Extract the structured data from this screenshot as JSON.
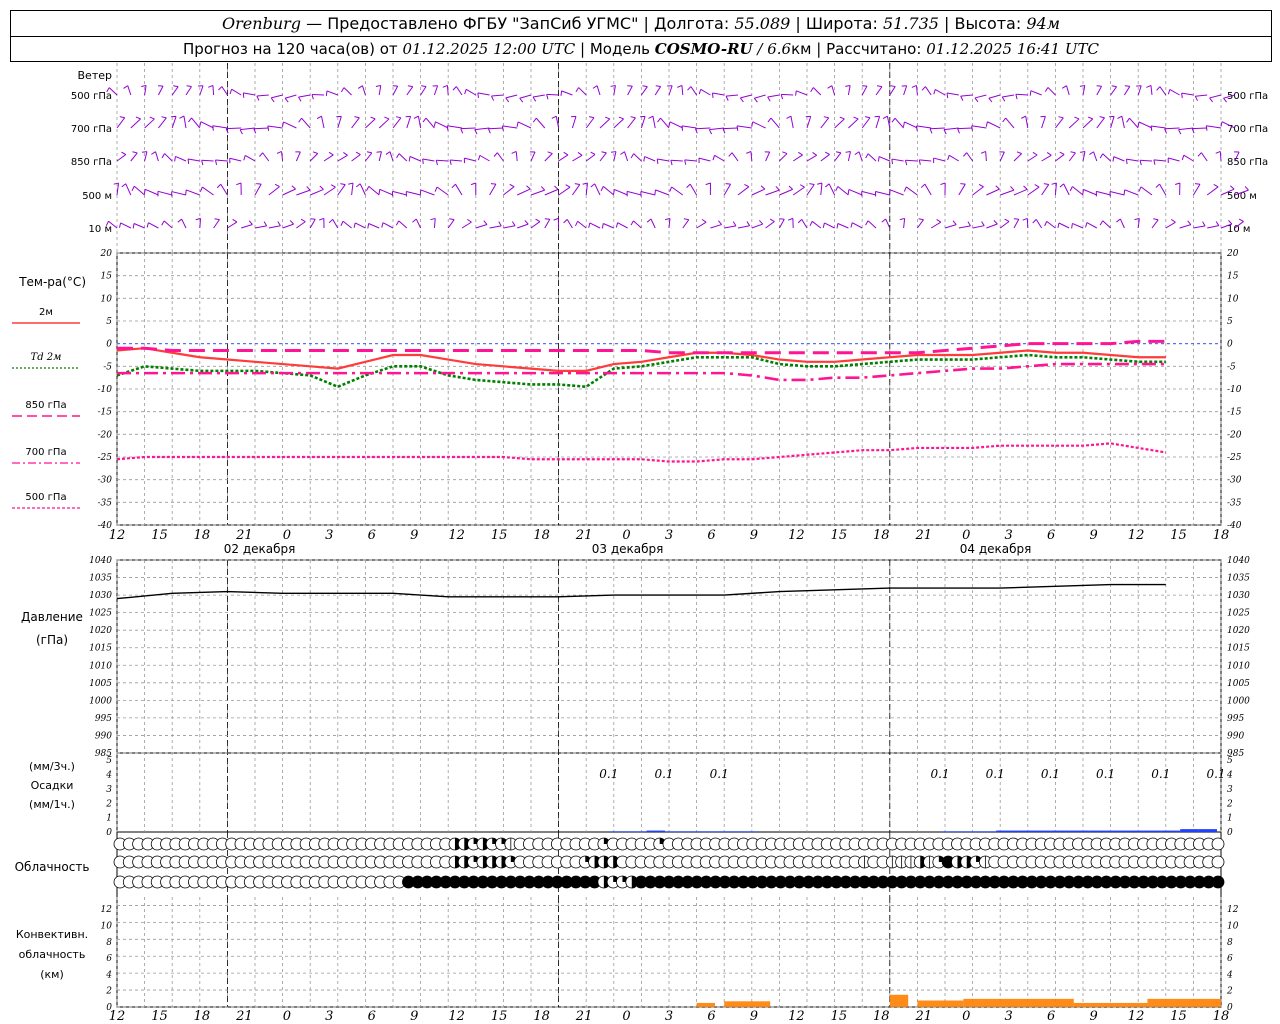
{
  "header": {
    "city": "Orenburg",
    "provider": "— Предоставлено ФГБУ \"ЗапСиб УГМС\"",
    "lon_label": "Долгота:",
    "lon": "55.089",
    "lat_label": "Широта:",
    "lat": "51.735",
    "alt_label": "Высота:",
    "alt": "94м",
    "forecast_prefix": "Прогноз на 120 часа(ов)  от",
    "forecast_time": "01.12.2025 12:00 UTC",
    "model_label": "Модель",
    "model": "COSMO-RU",
    "model_res": "/ 6.6",
    "model_unit": "км",
    "calc_label": "Рассчитано:",
    "calc_time": "01.12.2025 16:41 UTC"
  },
  "labels": {
    "wind": "Ветер",
    "wind_levels": [
      "500 гПа",
      "700 гПа",
      "850 гПа",
      "500 м",
      "10  м"
    ],
    "temp_title": "Тем-ра(°C)",
    "temp_legend": [
      "2м",
      "Td  2м",
      "850 гПа",
      "700 гПа",
      "500 гПа"
    ],
    "pressure_title": "Давление",
    "pressure_unit": "(гПа)",
    "precip_unit_top": "(мм/3ч.)",
    "precip_title": "Осадки",
    "precip_unit_bottom": "(мм/1ч.)",
    "cloud_title": "Облачность",
    "conv_title_1": "Конвективн.",
    "conv_title_2": "облачность",
    "conv_unit": "(км)"
  },
  "axis": {
    "hour_labels": [
      "12",
      "15",
      "18",
      "21",
      "0",
      "3",
      "6",
      "9",
      "12",
      "15",
      "18",
      "21",
      "0",
      "3",
      "6",
      "9",
      "12",
      "15",
      "18",
      "21",
      "0",
      "3",
      "6",
      "9",
      "12",
      "15",
      "18"
    ],
    "date_labels": [
      "02 декабря",
      "03 декабря",
      "04 декабря"
    ],
    "temp_ticks": [
      "20",
      "15",
      "10",
      "5",
      "0",
      "-5",
      "-10",
      "-15",
      "-20",
      "-25",
      "-30",
      "-35",
      "-40"
    ],
    "pressure_ticks": [
      "1040",
      "1035",
      "1030",
      "1025",
      "1020",
      "1015",
      "1010",
      "1005",
      "1000",
      "995",
      "990",
      "985"
    ],
    "precip_ticks": [
      "5",
      "4",
      "3",
      "2",
      "1",
      "0"
    ],
    "conv_ticks": [
      "12",
      "10",
      "8",
      "6",
      "4",
      "2",
      "0"
    ]
  },
  "colors": {
    "t2m": "#ff3b3b",
    "td2m": "#008000",
    "t850": "#ff1493",
    "t700": "#ff1493",
    "t500": "#ff1493",
    "wind": "#9400d3",
    "pressure": "#000000",
    "precip": "#2040ff",
    "conv": "#ff7f00"
  },
  "chart_data": {
    "type": "line",
    "x_unit": "hours since 01.12.2025 12:00 UTC",
    "temperature": {
      "ylim": [
        -40,
        20
      ],
      "series": [
        {
          "name": "2м",
          "x": [
            0,
            3,
            6,
            9,
            12,
            15,
            18,
            21,
            24,
            27,
            30,
            33,
            36,
            39,
            42,
            45,
            48,
            51,
            54,
            57,
            60,
            63,
            66,
            69,
            72,
            75,
            78,
            81,
            84,
            87,
            90,
            93,
            96,
            99,
            102,
            105,
            108,
            111,
            114
          ],
          "y": [
            -1.5,
            -1,
            -2,
            -3,
            -3.5,
            -4,
            -4.5,
            -5,
            -5.5,
            -4,
            -2.5,
            -2.5,
            -3.5,
            -4.5,
            -5,
            -5.5,
            -6,
            -6,
            -4.5,
            -4,
            -3,
            -2,
            -2,
            -2.5,
            -3.5,
            -4,
            -4,
            -3.5,
            -3,
            -2.5,
            -2.5,
            -2.5,
            -2,
            -1.5,
            -2,
            -2,
            -2.5,
            -3,
            -3
          ]
        },
        {
          "name": "Td  2м",
          "x": [
            0,
            3,
            6,
            9,
            12,
            15,
            18,
            21,
            24,
            27,
            30,
            33,
            36,
            39,
            42,
            45,
            48,
            51,
            54,
            57,
            60,
            63,
            66,
            69,
            72,
            75,
            78,
            81,
            84,
            87,
            90,
            93,
            96,
            99,
            102,
            105,
            108,
            111,
            114
          ],
          "y": [
            -7,
            -5,
            -5.5,
            -6,
            -6,
            -6,
            -6.5,
            -7,
            -9.5,
            -7,
            -5,
            -5,
            -7,
            -8,
            -8.5,
            -9,
            -9,
            -9.5,
            -5.5,
            -5,
            -4,
            -3,
            -3,
            -3,
            -4.5,
            -5,
            -5,
            -4.5,
            -4,
            -3.5,
            -3.5,
            -3.5,
            -3,
            -2.5,
            -3,
            -3,
            -3.5,
            -4,
            -4
          ]
        },
        {
          "name": "850 гПа",
          "x": [
            0,
            3,
            6,
            9,
            12,
            15,
            18,
            21,
            24,
            27,
            30,
            33,
            36,
            39,
            42,
            45,
            48,
            51,
            54,
            57,
            60,
            63,
            66,
            69,
            72,
            75,
            78,
            81,
            84,
            87,
            90,
            93,
            96,
            99,
            102,
            105,
            108,
            111,
            114
          ],
          "y": [
            -1,
            -1,
            -1.5,
            -1.5,
            -1.5,
            -1.5,
            -1.5,
            -1.5,
            -1.5,
            -1.5,
            -1.5,
            -1.5,
            -1.5,
            -1.5,
            -1.5,
            -1.5,
            -1.5,
            -1.5,
            -1.5,
            -1.5,
            -2,
            -2,
            -2,
            -2,
            -2,
            -2,
            -2,
            -2,
            -2,
            -2,
            -1.5,
            -1,
            -0.5,
            0,
            0,
            0,
            0,
            0.5,
            0.5
          ]
        },
        {
          "name": "700 гПа",
          "x": [
            0,
            3,
            6,
            9,
            12,
            15,
            18,
            21,
            24,
            27,
            30,
            33,
            36,
            39,
            42,
            45,
            48,
            51,
            54,
            57,
            60,
            63,
            66,
            69,
            72,
            75,
            78,
            81,
            84,
            87,
            90,
            93,
            96,
            99,
            102,
            105,
            108,
            111,
            114
          ],
          "y": [
            -6.5,
            -6.5,
            -6.5,
            -6.5,
            -6.5,
            -6.5,
            -6.5,
            -6.5,
            -6.5,
            -6.5,
            -6.5,
            -6.5,
            -6.5,
            -6.5,
            -6.5,
            -6.5,
            -6.5,
            -6.5,
            -6.5,
            -6.5,
            -6.5,
            -6.5,
            -6.5,
            -7,
            -8,
            -8,
            -7.5,
            -7.5,
            -7,
            -6.5,
            -6,
            -5.5,
            -5.5,
            -5,
            -4.5,
            -4.5,
            -4.5,
            -4.5,
            -4.5
          ]
        },
        {
          "name": "500 гПа",
          "x": [
            0,
            3,
            6,
            9,
            12,
            15,
            18,
            21,
            24,
            27,
            30,
            33,
            36,
            39,
            42,
            45,
            48,
            51,
            54,
            57,
            60,
            63,
            66,
            69,
            72,
            75,
            78,
            81,
            84,
            87,
            90,
            93,
            96,
            99,
            102,
            105,
            108,
            111,
            114
          ],
          "y": [
            -25.5,
            -25,
            -25,
            -25,
            -25,
            -25,
            -25,
            -25,
            -25,
            -25,
            -25,
            -25,
            -25,
            -25,
            -25,
            -25.5,
            -25.5,
            -25.5,
            -25.5,
            -25.5,
            -26,
            -26,
            -25.5,
            -25.5,
            -25,
            -24.5,
            -24,
            -23.5,
            -23.5,
            -23,
            -23,
            -23,
            -22.5,
            -22.5,
            -22.5,
            -22.5,
            -22,
            -23,
            -24
          ]
        }
      ]
    },
    "pressure": {
      "ylim": [
        985,
        1040
      ],
      "x": [
        0,
        6,
        12,
        18,
        24,
        30,
        36,
        42,
        48,
        54,
        60,
        66,
        72,
        78,
        84,
        90,
        96,
        102,
        108,
        114
      ],
      "y": [
        1029,
        1030.5,
        1031,
        1030.5,
        1030.5,
        1030.5,
        1029.5,
        1029.5,
        1029.5,
        1030,
        1030,
        1030,
        1031,
        1031.5,
        1032,
        1032,
        1032,
        1032.5,
        1033,
        1033
      ]
    },
    "precip_3h_labels": [
      {
        "x": 54,
        "value": "0.1"
      },
      {
        "x": 60,
        "value": "0.1"
      },
      {
        "x": 66,
        "value": "0.1"
      },
      {
        "x": 90,
        "value": "0.1"
      },
      {
        "x": 96,
        "value": "0.1"
      },
      {
        "x": 102,
        "value": "0.1"
      },
      {
        "x": 108,
        "value": "0.1"
      },
      {
        "x": 114,
        "value": "0.1"
      },
      {
        "x": 120,
        "value": "0.1"
      }
    ],
    "precip_1h": {
      "x": [
        54,
        56,
        58,
        60,
        62,
        64,
        66,
        68,
        90,
        92,
        94,
        96,
        98,
        100,
        102,
        104,
        106,
        108,
        110,
        112,
        114,
        116,
        118
      ],
      "y": [
        0.05,
        0.05,
        0.1,
        0.05,
        0.05,
        0.05,
        0.05,
        0.05,
        0.05,
        0.05,
        0.05,
        0.1,
        0.1,
        0.1,
        0.1,
        0.1,
        0.1,
        0.1,
        0.1,
        0.1,
        0.1,
        0.2,
        0.2
      ]
    },
    "cloud_rows": {
      "row1": "000000000000000000000000000000000000332322100000000020000020000000000000000000000000000000000000000000000000000000000000",
      "row2": "000000000000000000000000000000000000332333200000002333000000000000000000000000001001113124332100000000000000000000000000",
      "row3": "000000000000000000000000000000044444444444444444444432234444444444444444444444444444444444444444444444444444444444444444"
    },
    "conv": {
      "ylim": [
        0,
        13
      ],
      "segments": [
        {
          "x0": 63,
          "x1": 65,
          "y": 0.5
        },
        {
          "x0": 66,
          "x1": 71,
          "y": 0.7
        },
        {
          "x0": 84,
          "x1": 86,
          "y": 1.5
        },
        {
          "x0": 87,
          "x1": 92,
          "y": 0.8
        },
        {
          "x0": 92,
          "x1": 104,
          "y": 1
        },
        {
          "x0": 104,
          "x1": 112,
          "y": 0.5
        },
        {
          "x0": 112,
          "x1": 120,
          "y": 1
        }
      ]
    },
    "wind_speed_note": ""
  }
}
